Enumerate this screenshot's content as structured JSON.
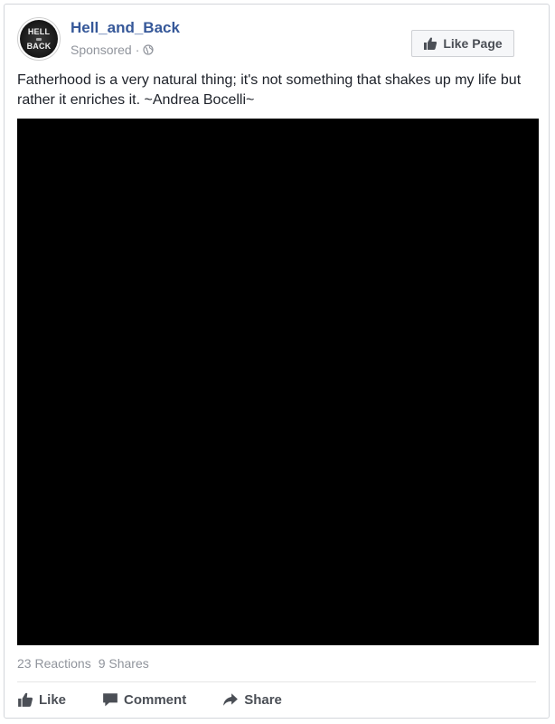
{
  "post": {
    "page_name": "Hell_and_Back",
    "sponsored_label": "Sponsored",
    "separator": "·",
    "privacy_icon": "globe-icon",
    "avatar": {
      "line1": "HELL",
      "line2": "BACK"
    },
    "like_page_label": "Like Page",
    "text": "Fatherhood is a very natural thing; it's not something that shakes up my life but rather it enriches it. ~Andrea Bocelli~"
  },
  "stats": {
    "reactions": "23 Reactions",
    "shares": "9 Shares"
  },
  "actions": {
    "like_label": "Like",
    "comment_label": "Comment",
    "share_label": "Share"
  },
  "colors": {
    "link": "#365899",
    "meta": "#90949c",
    "action_text": "#4b4f56",
    "media_bg": "#000000"
  }
}
